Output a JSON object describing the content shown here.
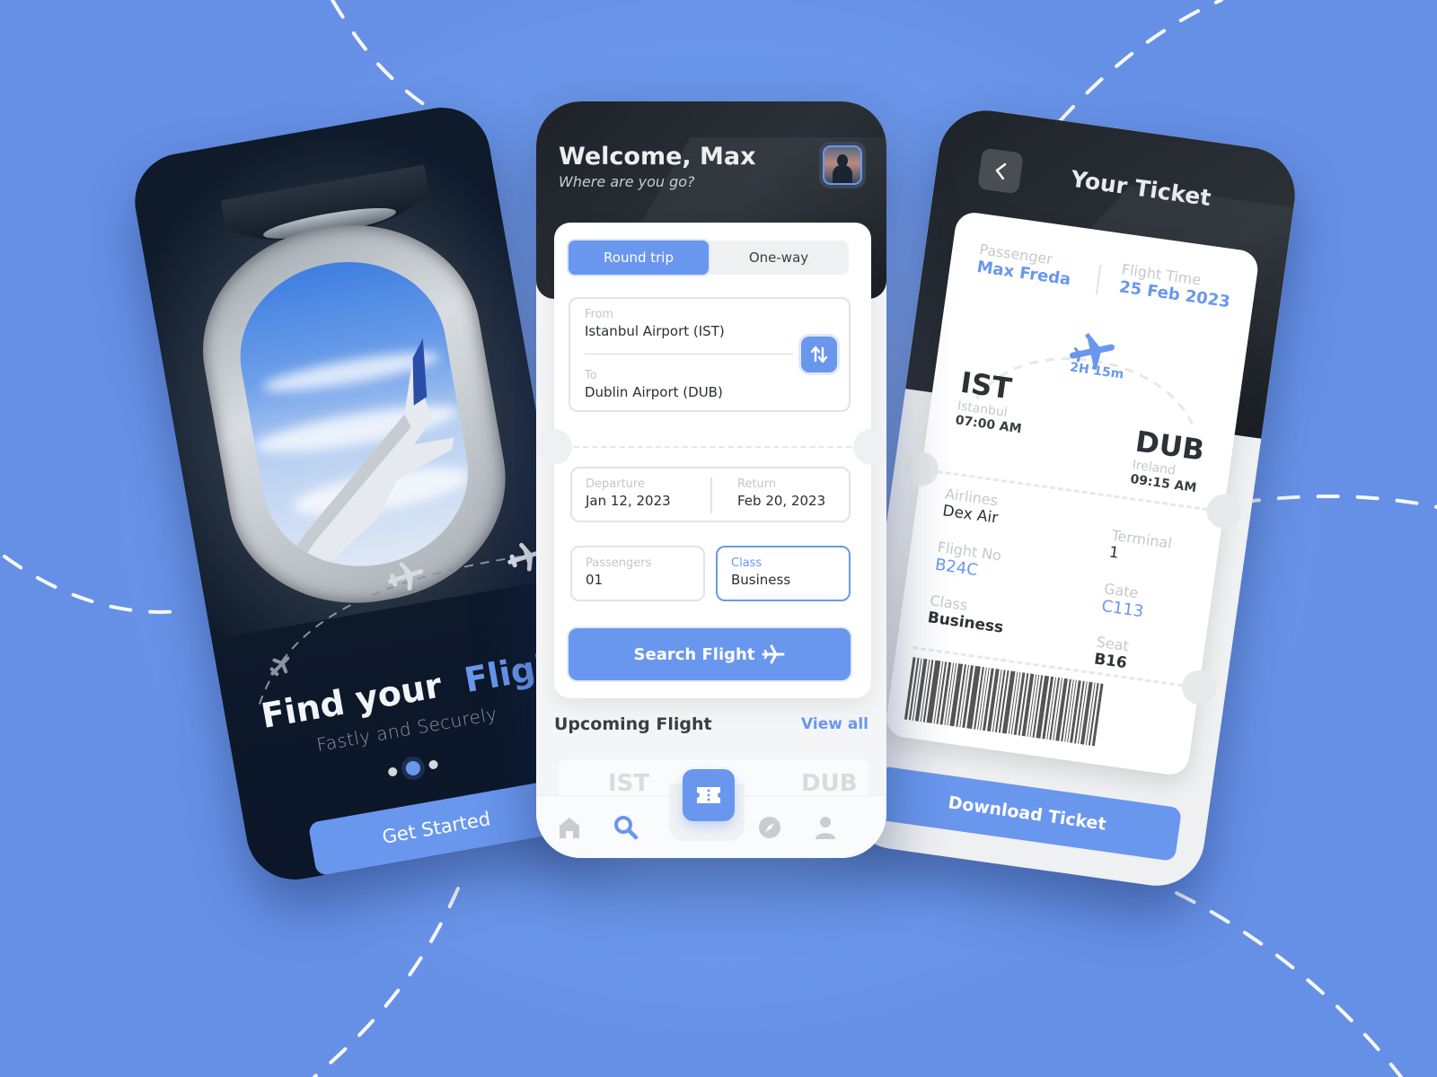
{
  "theme": {
    "accent": "#6a97ee",
    "background": "#6b97ea",
    "dark_header": "#1f242b",
    "text_dark": "#2e3136",
    "text_muted": "#c5c8cc"
  },
  "onboarding_screen": {
    "title_part1": "Find your",
    "title_part2": "Flight",
    "subtitle": "Fastly and Securely",
    "pager": {
      "total": 3,
      "active_index": 1
    },
    "get_started_label": "Get Started",
    "icons": [
      "airplane-window-image",
      "airplane-icon",
      "dashed-flight-path"
    ]
  },
  "search_screen": {
    "greeting": "Welcome, Max",
    "greeting_sub": "Where are you go?",
    "avatar_icon": "user-avatar",
    "trip_type": {
      "options": [
        "Round trip",
        "One-way"
      ],
      "selected": "Round trip"
    },
    "from": {
      "label": "From",
      "value": "Istanbul Airport (IST)"
    },
    "to": {
      "label": "To",
      "value": "Dublin Airport (DUB)"
    },
    "swap_icon": "swap-vertical-icon",
    "departure": {
      "label": "Departure",
      "value": "Jan 12, 2023"
    },
    "return": {
      "label": "Return",
      "value": "Feb 20, 2023"
    },
    "passengers": {
      "label": "Passengers",
      "value": "01"
    },
    "class": {
      "label": "Class",
      "value": "Business"
    },
    "search_button": "Search Flight",
    "upcoming_title": "Upcoming Flight",
    "view_all": "View all",
    "upcoming_preview": {
      "from": "IST",
      "to": "DUB"
    },
    "bottom_nav": [
      {
        "id": "home",
        "icon": "home-icon",
        "active": false
      },
      {
        "id": "search",
        "icon": "search-icon",
        "active": true
      },
      {
        "id": "tickets",
        "icon": "ticket-icon",
        "active": false
      },
      {
        "id": "explore",
        "icon": "compass-icon",
        "active": false
      },
      {
        "id": "profile",
        "icon": "user-icon",
        "active": false
      }
    ]
  },
  "ticket_screen": {
    "title": "Your Ticket",
    "back_icon": "chevron-left-icon",
    "passenger": {
      "label": "Passenger",
      "value": "Max Freda"
    },
    "flight_time": {
      "label": "Flight Time",
      "value": "25 Feb 2023"
    },
    "duration": "2H 15m",
    "origin": {
      "code": "IST",
      "city": "Istanbul",
      "time": "07:00 AM"
    },
    "destination": {
      "code": "DUB",
      "city": "Ireland",
      "time": "09:15 AM"
    },
    "airlines": {
      "label": "Airlines",
      "value": "Dex Air"
    },
    "terminal": {
      "label": "Terminal",
      "value": "1"
    },
    "flight_no": {
      "label": "Flight No",
      "value": "B24C"
    },
    "gate": {
      "label": "Gate",
      "value": "C113"
    },
    "class": {
      "label": "Class",
      "value": "Business"
    },
    "seat": {
      "label": "Seat",
      "value": "B16"
    },
    "download_button": "Download Ticket"
  }
}
